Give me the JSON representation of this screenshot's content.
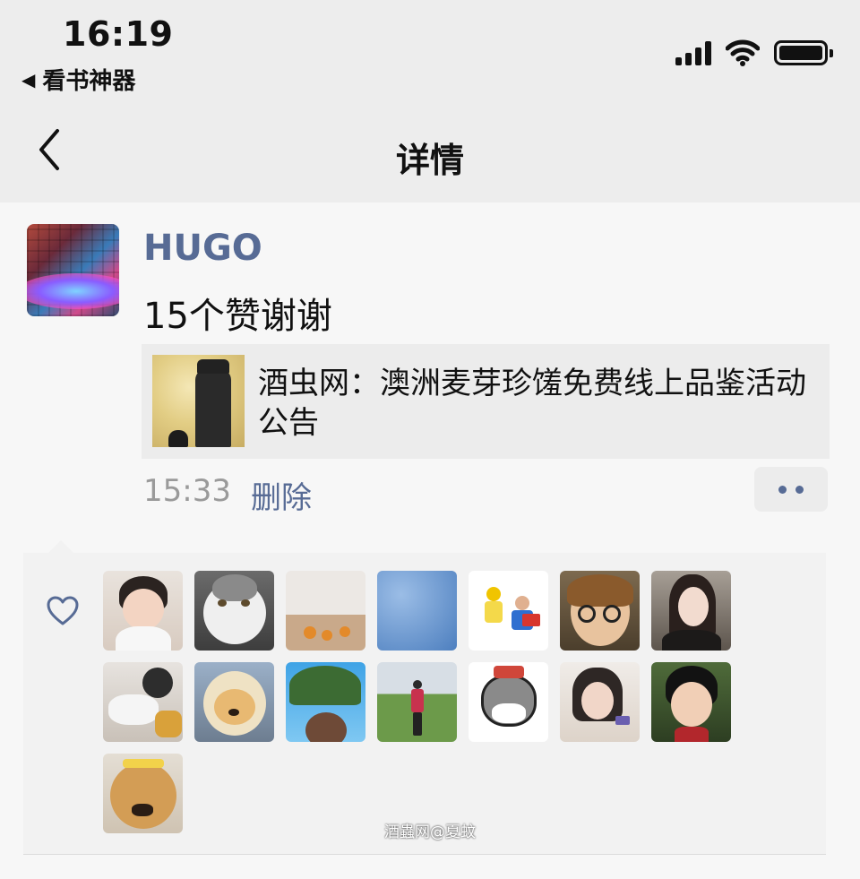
{
  "status_bar": {
    "time": "16:19",
    "back_app": "看书神器"
  },
  "nav": {
    "title": "详情",
    "back_icon": "chevron-left-icon"
  },
  "post": {
    "username": "HUGO",
    "text": "15个赞谢谢",
    "link_title": "酒虫网：澳洲麦芽珍馐免费线上品鉴活动公告",
    "time": "15:33",
    "delete_label": "删除"
  },
  "likes": {
    "icon": "heart-icon",
    "count": 15
  },
  "watermark": "酒蟲网@夏蚊",
  "colors": {
    "link_blue": "#576b95",
    "nav_bg": "#ededed",
    "page_bg": "#f7f7f7",
    "likes_bg": "#f2f2f2"
  }
}
